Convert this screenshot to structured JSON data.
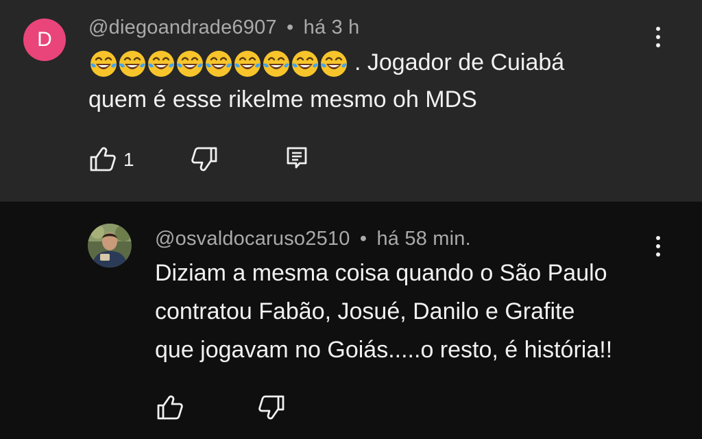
{
  "comment": {
    "avatar_letter": "D",
    "handle": "@diegoandrade6907",
    "separator": "•",
    "time": "há 3 h",
    "emoji": "😂😂😂😂😂😂😂😂😂",
    "emoji_count": 9,
    "text_line1_after_emoji": ".  Jogador de Cuiabá",
    "text_line2": "quem é esse rikelme mesmo oh MDS",
    "like_count": "1",
    "icons": [
      "thumb-up-icon",
      "thumb-down-icon",
      "reply-icon",
      "more-vert-icon"
    ]
  },
  "reply": {
    "handle": "@osvaldocaruso2510",
    "separator": "•",
    "time": "há 58 min.",
    "text_lines": [
      "Diziam a mesma coisa quando o São Paulo",
      "contratou Fabão, Josué, Danilo e Grafite",
      "que jogavam no Goiás.....o resto, é história!!"
    ],
    "icons": [
      "thumb-up-icon",
      "thumb-down-icon",
      "more-vert-icon"
    ]
  },
  "colors": {
    "top_background": "#272727",
    "reply_background": "#0f0f0f",
    "avatar": "#e9457a",
    "meta_text": "#aaaaaa",
    "body_text": "#f1f1f1"
  }
}
